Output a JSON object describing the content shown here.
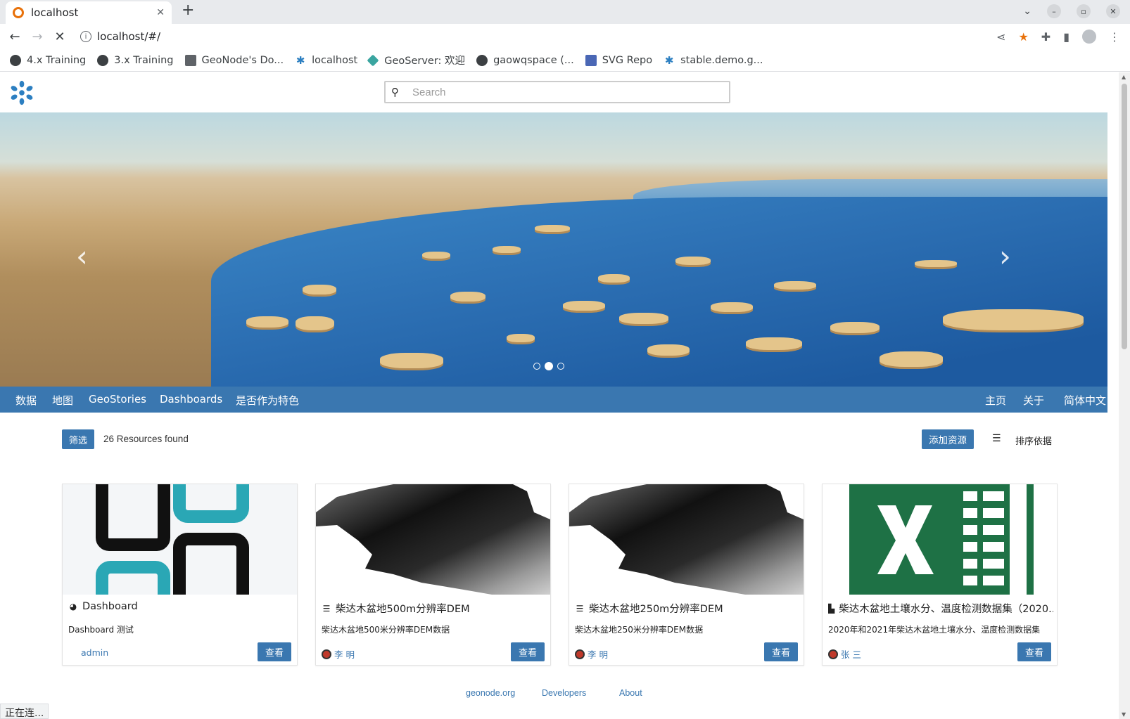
{
  "browser": {
    "tab_title": "localhost",
    "url": "localhost/#/",
    "bookmarks": [
      "4.x Training",
      "3.x Training",
      "GeoNode's Do...",
      "localhost",
      "GeoServer: 欢迎",
      "gaowqspace (...",
      "SVG Repo",
      "stable.demo.g..."
    ],
    "status_text": "正在连..."
  },
  "header": {
    "search_placeholder": "Search"
  },
  "carousel": {
    "active_index": 1,
    "slide_count": 3
  },
  "menu": {
    "left": [
      "数据",
      "地图",
      "GeoStories",
      "Dashboards",
      "是否作为特色"
    ],
    "right": [
      "主页",
      "关于",
      "简体中文"
    ]
  },
  "toolbar": {
    "filter_label": "筛选",
    "count_text": "26 Resources found",
    "add_label": "添加资源",
    "sort_label": "排序依据"
  },
  "cards": [
    {
      "icon": "dashboard-icon",
      "title": "Dashboard",
      "abstract": "Dashboard 测试",
      "owner": "admin",
      "view_label": "查看"
    },
    {
      "icon": "layer-icon",
      "title": "柴达木盆地500m分辨率DEM",
      "abstract": "柴达木盆地500米分辨率DEM数据",
      "owner": "李 明",
      "view_label": "查看"
    },
    {
      "icon": "layer-icon",
      "title": "柴达木盆地250m分辨率DEM",
      "abstract": "柴达木盆地250米分辨率DEM数据",
      "owner": "李 明",
      "view_label": "查看"
    },
    {
      "icon": "document-icon",
      "title": "柴达木盆地土壤水分、温度检测数据集（2020...",
      "abstract": "2020年和2021年柴达木盆地土壤水分、温度检测数据集",
      "owner": "张 三",
      "view_label": "查看"
    }
  ],
  "footer": {
    "links": [
      "geonode.org",
      "Developers",
      "About"
    ]
  }
}
